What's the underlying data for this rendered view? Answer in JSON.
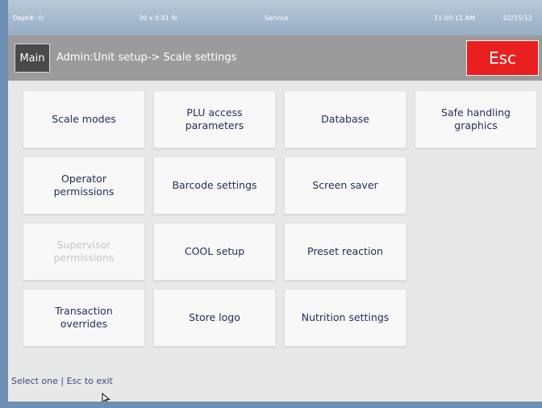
{
  "status_bar": {
    "dept": "Dept#: 0:",
    "weight": "30 x 0.01 lb",
    "mode": "Service",
    "time": "11:00:11 AM",
    "date": "02/15/12"
  },
  "header": {
    "main_label": "Main",
    "breadcrumb": "Admin:Unit setup-> Scale settings",
    "esc_label": "Esc"
  },
  "colors": {
    "esc": "#ea1f1f",
    "header": "#9b9b9b",
    "tile_text": "#1f2d5a",
    "disabled_text": "#c4c4c4"
  },
  "tiles": {
    "scale_modes": "Scale modes",
    "plu_access_1": "PLU access",
    "plu_access_2": "parameters",
    "database": "Database",
    "safe_handling_1": "Safe handling",
    "safe_handling_2": "graphics",
    "operator_1": "Operator",
    "operator_2": "permissions",
    "barcode": "Barcode settings",
    "screen_saver": "Screen saver",
    "supervisor_1": "Supervisor",
    "supervisor_2": "permissions",
    "cool_setup": "COOL setup",
    "preset_reaction": "Preset reaction",
    "transaction_1": "Transaction",
    "transaction_2": "overrides",
    "store_logo": "Store logo",
    "nutrition": "Nutrition settings"
  },
  "footer": {
    "hint": "Select one | Esc to exit"
  },
  "icons": {
    "cursor": "mouse-pointer-icon"
  }
}
